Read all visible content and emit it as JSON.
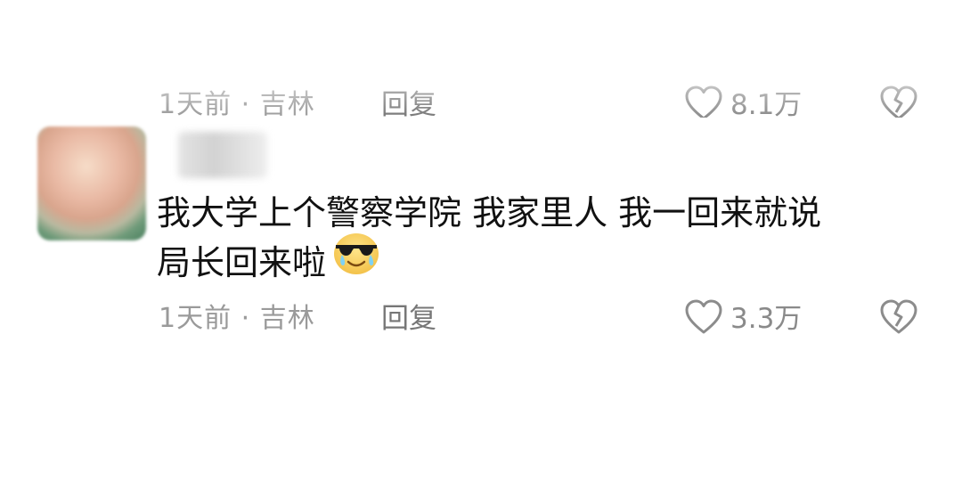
{
  "previous_comment": {
    "time_location": "1天前 · 吉林",
    "reply_label": "回复",
    "like_count": "8.1万"
  },
  "comment": {
    "username": "用户",
    "text_line1": "我大学上个警察学院 我家里人 我一回来就说",
    "text_line2": "局长回来啦",
    "emoji_name": "cool-sunglasses-emoji",
    "time_location": "1天前 · 吉林",
    "reply_label": "回复",
    "like_count": "3.3万"
  },
  "colors": {
    "meta_text": "#9a9a9a",
    "reply_text": "#777777",
    "main_text": "#111111",
    "icon_stroke": "#8c8c8c"
  }
}
